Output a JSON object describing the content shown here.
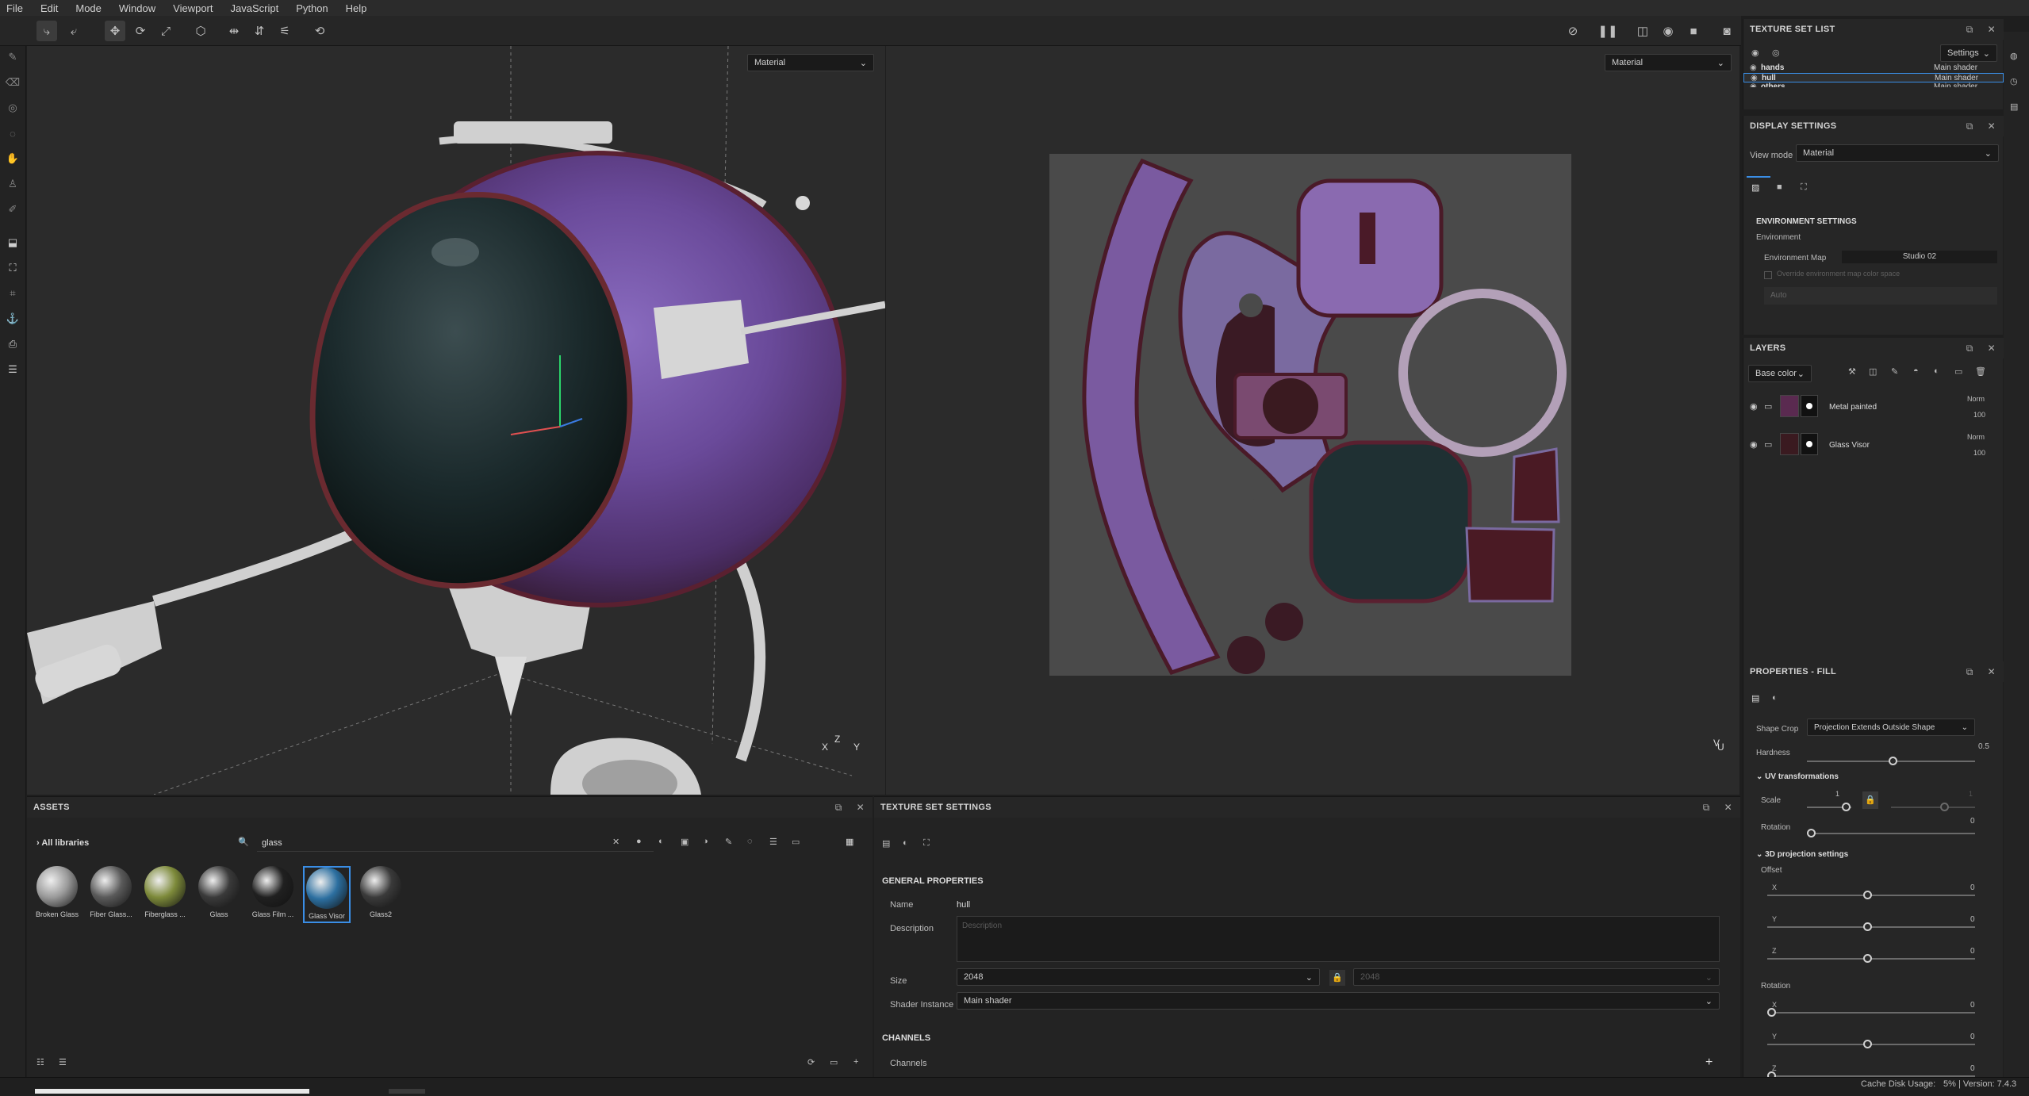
{
  "menu": [
    "File",
    "Edit",
    "Mode",
    "Window",
    "Viewport",
    "JavaScript",
    "Python",
    "Help"
  ],
  "viewport3d": {
    "mode": "Material"
  },
  "viewport2d": {
    "mode": "Material"
  },
  "texture_set_list": {
    "title": "TEXTURE SET LIST",
    "settings_label": "Settings",
    "items": [
      {
        "name": "hands",
        "shader": "Main shader"
      },
      {
        "name": "hull",
        "shader": "Main shader"
      },
      {
        "name": "others",
        "shader": "Main shader"
      }
    ]
  },
  "display_settings": {
    "title": "DISPLAY SETTINGS",
    "view_mode_label": "View mode",
    "view_mode_value": "Material",
    "env_title": "ENVIRONMENT SETTINGS",
    "env_sub": "Environment",
    "env_map_label": "Environment Map",
    "env_map_value": "Studio 02",
    "override_label": "Override environment map color space",
    "auto_label": "Auto"
  },
  "layers": {
    "title": "LAYERS",
    "channel": "Base color",
    "items": [
      {
        "name": "Metal painted",
        "blend": "Norm",
        "opacity": "100"
      },
      {
        "name": "Glass Visor",
        "blend": "Norm",
        "opacity": "100"
      }
    ]
  },
  "properties_fill": {
    "title": "PROPERTIES - FILL",
    "shape_crop_label": "Shape Crop",
    "shape_crop_value": "Projection Extends Outside Shape",
    "hardness_label": "Hardness",
    "hardness_value": "0.5",
    "uv_title": "UV transformations",
    "scale_label": "Scale",
    "scale_value": "1",
    "scale_value2": "1",
    "rotation_label": "Rotation",
    "rotation_value": "0",
    "proj_title": "3D projection settings",
    "offset_label": "Offset",
    "offset": [
      {
        "axis": "X",
        "value": "0"
      },
      {
        "axis": "Y",
        "value": "0"
      },
      {
        "axis": "Z",
        "value": "0"
      }
    ],
    "rot_label": "Rotation",
    "rot": [
      {
        "axis": "X",
        "value": "0"
      },
      {
        "axis": "Y",
        "value": "0"
      },
      {
        "axis": "Z",
        "value": "0"
      }
    ]
  },
  "assets": {
    "title": "ASSETS",
    "library": "All libraries",
    "search": "glass",
    "items": [
      {
        "label": "Broken Glass",
        "color": "#9a9a9a"
      },
      {
        "label": "Fiber Glass...",
        "color": "#5a5a5a"
      },
      {
        "label": "Fiberglass ...",
        "color": "#7d8a3a"
      },
      {
        "label": "Glass",
        "color": "#3a3a3a"
      },
      {
        "label": "Glass Film ...",
        "color": "#202020"
      },
      {
        "label": "Glass Visor",
        "color": "#2c6fa0"
      },
      {
        "label": "Glass2",
        "color": "#3a3a3a"
      }
    ]
  },
  "texture_set_settings": {
    "title": "TEXTURE SET SETTINGS",
    "general_title": "GENERAL PROPERTIES",
    "name_label": "Name",
    "name_value": "hull",
    "desc_label": "Description",
    "desc_placeholder": "Description",
    "size_label": "Size",
    "size_value": "2048",
    "size_value2": "2048",
    "shader_label": "Shader Instance",
    "shader_value": "Main shader",
    "channels_title": "CHANNELS",
    "channels_label": "Channels"
  },
  "status": {
    "cache": "Cache Disk Usage:",
    "version": "5% | Version: 7.4.3"
  }
}
